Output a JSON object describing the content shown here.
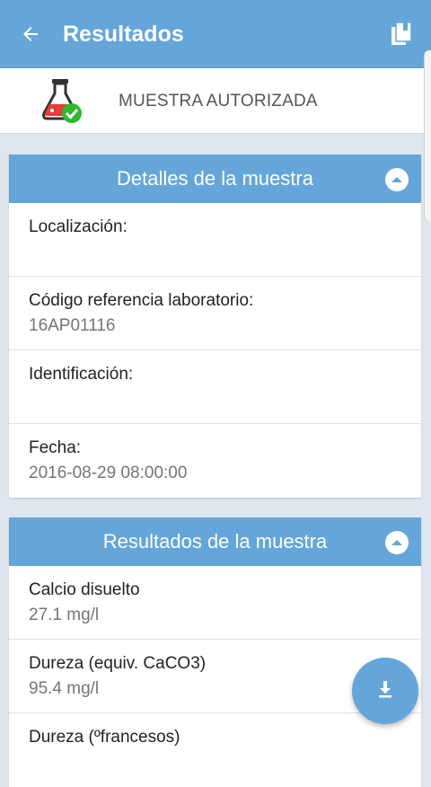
{
  "appbar": {
    "title": "Resultados",
    "back_icon": "arrow-left-icon",
    "action_icon": "book-icon"
  },
  "status": {
    "label": "MUESTRA AUTORIZADA",
    "icon": "flask-check-icon"
  },
  "details": {
    "title": "Detalles de la muestra",
    "rows": [
      {
        "label": "Localización:",
        "value": ""
      },
      {
        "label": "Código referencia laboratorio:",
        "value": "16AP01116"
      },
      {
        "label": "Identificación:",
        "value": ""
      },
      {
        "label": "Fecha:",
        "value": "2016-08-29 08:00:00"
      }
    ]
  },
  "results": {
    "title": "Resultados de la muestra",
    "rows": [
      {
        "label": "Calcio disuelto",
        "value": "27.1 mg/l"
      },
      {
        "label": "Dureza (equiv. CaCO3)",
        "value": "95.4 mg/l"
      },
      {
        "label": "Dureza (ºfrancesos)",
        "value": ""
      }
    ]
  },
  "fab": {
    "icon": "download-icon"
  },
  "colors": {
    "primary": "#64a6d9",
    "background": "#dfe6ee",
    "accent_green": "#2eb82e",
    "flask_red": "#e43b3b"
  }
}
